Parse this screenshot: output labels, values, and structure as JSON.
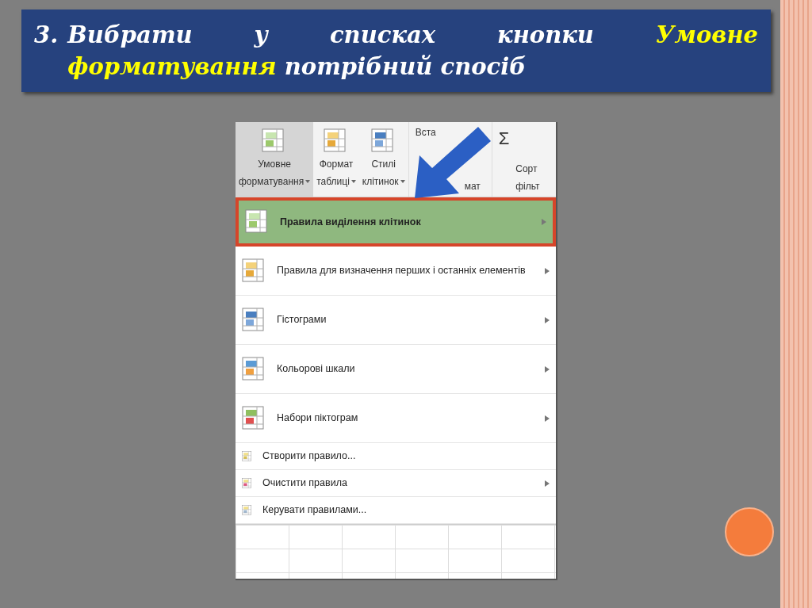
{
  "slide": {
    "number": "3.",
    "title": [
      {
        "text": "Вибрати у списках кнопки ",
        "highlight": false
      },
      {
        "text": "Умовне форматування",
        "highlight": true
      },
      {
        "text": " потрібний спосіб",
        "highlight": false
      }
    ]
  },
  "ribbon": {
    "buttons": [
      {
        "line1": "Умовне",
        "line2": "форматування",
        "selected": true
      },
      {
        "line1": "Формат",
        "line2": "таблиці",
        "selected": false
      },
      {
        "line1": "Стилі",
        "line2": "клітинок",
        "selected": false
      }
    ],
    "cells_group": [
      "Вста",
      "мат"
    ],
    "editing": {
      "sum": "Σ"
    },
    "sort": [
      "Сорт",
      "фільт"
    ]
  },
  "menu": [
    {
      "kind": "large",
      "label": "Правила виділення клітинок",
      "submenu": true,
      "selected": true
    },
    {
      "kind": "large",
      "label": "Правила для визначення перших і останніх елементів",
      "submenu": true,
      "selected": false
    },
    {
      "kind": "large",
      "label": "Гістограми",
      "submenu": true,
      "selected": false
    },
    {
      "kind": "large",
      "label": "Кольорові шкали",
      "submenu": true,
      "selected": false
    },
    {
      "kind": "large",
      "label": "Набори піктограм",
      "submenu": true,
      "selected": false
    },
    {
      "kind": "small",
      "label": "Створити правило...",
      "submenu": false,
      "selected": false
    },
    {
      "kind": "small",
      "label": "Очистити правила",
      "submenu": true,
      "selected": false
    },
    {
      "kind": "small",
      "label": "Керувати правилами...",
      "submenu": false,
      "selected": false
    }
  ]
}
